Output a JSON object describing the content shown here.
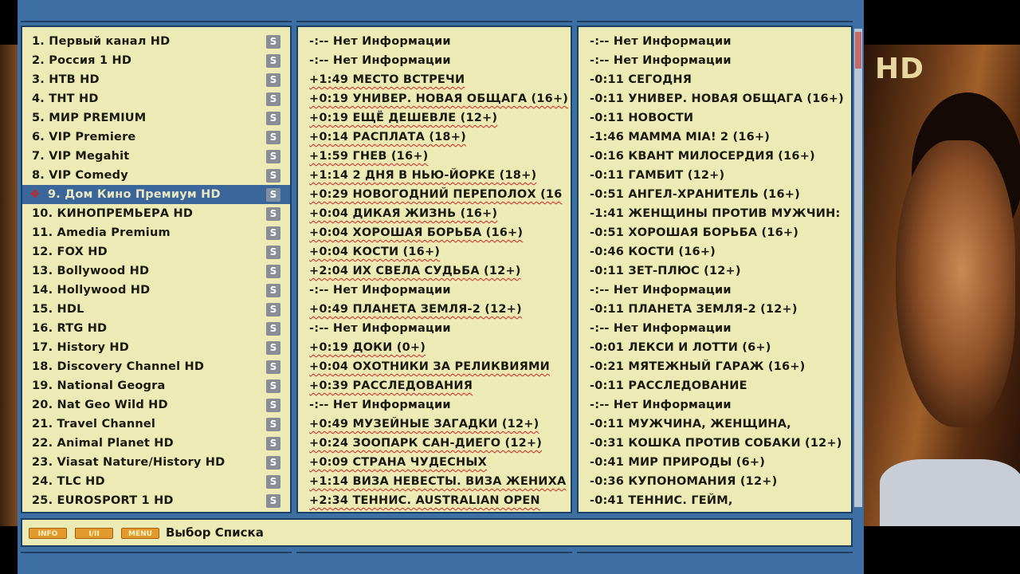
{
  "video": {
    "logo": "HD"
  },
  "channels": [
    {
      "label": "1. Первый канал HD"
    },
    {
      "label": "2. Россия 1 HD"
    },
    {
      "label": "3. НТВ HD"
    },
    {
      "label": "4. ТНТ HD"
    },
    {
      "label": "5. МИР PREMIUM"
    },
    {
      "label": "6. VIP Premiere"
    },
    {
      "label": "7. VIP Megahit"
    },
    {
      "label": "8. VIP Comedy"
    },
    {
      "label": "9. Дом Кино Премиум HD",
      "selected": true
    },
    {
      "label": "10. КИНОПРЕМЬЕРА HD"
    },
    {
      "label": "11. Amedia Premium"
    },
    {
      "label": "12. FOX HD"
    },
    {
      "label": "13. Bollywood HD"
    },
    {
      "label": "14. Hollywood HD"
    },
    {
      "label": "15. HDL"
    },
    {
      "label": "16. RTG HD"
    },
    {
      "label": "17. History HD"
    },
    {
      "label": "18. Discovery Channel HD"
    },
    {
      "label": "19. National Geogra"
    },
    {
      "label": "20. Nat Geo Wild HD"
    },
    {
      "label": "21. Travel Channel"
    },
    {
      "label": "22. Animal Planet HD"
    },
    {
      "label": "23. Viasat Nature/History HD"
    },
    {
      "label": "24. TLC HD"
    },
    {
      "label": "25. EUROSPORT 1 HD"
    }
  ],
  "scramble_badge": "S",
  "now": [
    {
      "text": "-:-- Нет Информации"
    },
    {
      "text": "-:-- Нет Информации"
    },
    {
      "text": "+1:49 МЕСТО ВСТРЕЧИ",
      "u": true
    },
    {
      "text": "+0:19 УНИВЕР. НОВАЯ ОБЩАГА (16+)",
      "u": true
    },
    {
      "text": "+0:19 ЕЩЁ ДЕШЕВЛЕ (12+)",
      "u": true
    },
    {
      "text": "+0:14 РАСПЛАТА (18+)",
      "u": true
    },
    {
      "text": "+1:59 ГНЕВ (16+)",
      "u": true
    },
    {
      "text": "+1:14 2 ДНЯ В НЬЮ-ЙОРКЕ (18+)",
      "u": true
    },
    {
      "text": "+0:29 НОВОГОДНИЙ ПЕРЕПОЛОХ (16",
      "u": true
    },
    {
      "text": "+0:04 ДИКАЯ ЖИЗНЬ (16+)",
      "u": true
    },
    {
      "text": "+0:04 ХОРОШАЯ БОРЬБА (16+)",
      "u": true
    },
    {
      "text": "+0:04 КОСТИ (16+)",
      "u": true
    },
    {
      "text": "+2:04 ИХ СВЕЛА СУДЬБА (12+)",
      "u": true
    },
    {
      "text": "-:-- Нет Информации"
    },
    {
      "text": "+0:49 ПЛАНЕТА ЗЕМЛЯ-2 (12+)",
      "u": true
    },
    {
      "text": "-:-- Нет Информации"
    },
    {
      "text": "+0:19 ДОКИ (0+)",
      "u": true
    },
    {
      "text": "+0:04 ОХОТНИКИ ЗА РЕЛИКВИЯМИ",
      "u": true
    },
    {
      "text": "+0:39 РАССЛЕДОВАНИЯ",
      "u": true
    },
    {
      "text": "-:-- Нет Информации"
    },
    {
      "text": "+0:49 МУЗЕЙНЫЕ ЗАГАДКИ (12+)",
      "u": true
    },
    {
      "text": "+0:24 ЗООПАРК САН-ДИЕГО (12+)",
      "u": true
    },
    {
      "text": "+0:09 СТРАНА ЧУДЕСНЫХ",
      "u": true
    },
    {
      "text": "+1:14 ВИЗА НЕВЕСТЫ. ВИЗА ЖЕНИХА",
      "u": true
    },
    {
      "text": "+2:34 ТЕННИС. AUSTRALIAN OPEN",
      "u": true
    }
  ],
  "next": [
    {
      "text": "-:-- Нет Информации"
    },
    {
      "text": "-:-- Нет Информации"
    },
    {
      "text": "-0:11 СЕГОДНЯ"
    },
    {
      "text": "-0:11 УНИВЕР. НОВАЯ ОБЩАГА (16+)"
    },
    {
      "text": "-0:11 НОВОСТИ"
    },
    {
      "text": "-1:46 МАММА MIA! 2 (16+)"
    },
    {
      "text": "-0:16 КВАНТ МИЛОСЕРДИЯ (16+)"
    },
    {
      "text": "-0:11 ГАМБИТ (12+)"
    },
    {
      "text": "-0:51 АНГЕЛ-ХРАНИТЕЛЬ (16+)"
    },
    {
      "text": "-1:41 ЖЕНЩИНЫ ПРОТИВ МУЖЧИН:"
    },
    {
      "text": "-0:51 ХОРОШАЯ БОРЬБА (16+)"
    },
    {
      "text": "-0:46 КОСТИ (16+)"
    },
    {
      "text": "-0:11 ЗЕТ-ПЛЮС (12+)"
    },
    {
      "text": "-:-- Нет Информации"
    },
    {
      "text": "-0:11 ПЛАНЕТА ЗЕМЛЯ-2 (12+)"
    },
    {
      "text": "-:-- Нет Информации"
    },
    {
      "text": "-0:01 ЛЕКСИ И ЛОТТИ (6+)"
    },
    {
      "text": "-0:21 МЯТЕЖНЫЙ ГАРАЖ (16+)"
    },
    {
      "text": "-0:11 РАССЛЕДОВАНИЕ"
    },
    {
      "text": "-:-- Нет Информации"
    },
    {
      "text": "-0:11 МУЖЧИНА, ЖЕНЩИНА,"
    },
    {
      "text": "-0:31 КОШКА ПРОТИВ СОБАКИ (12+)"
    },
    {
      "text": "-0:41 МИР ПРИРОДЫ (6+)"
    },
    {
      "text": "-0:36 КУПОНОМАНИЯ (12+)"
    },
    {
      "text": "-0:41 ТЕННИС. ГЕЙМ,"
    }
  ],
  "help": {
    "keys": [
      "INFO",
      "I/II",
      "MENU"
    ],
    "text": "Выбор Списка"
  }
}
